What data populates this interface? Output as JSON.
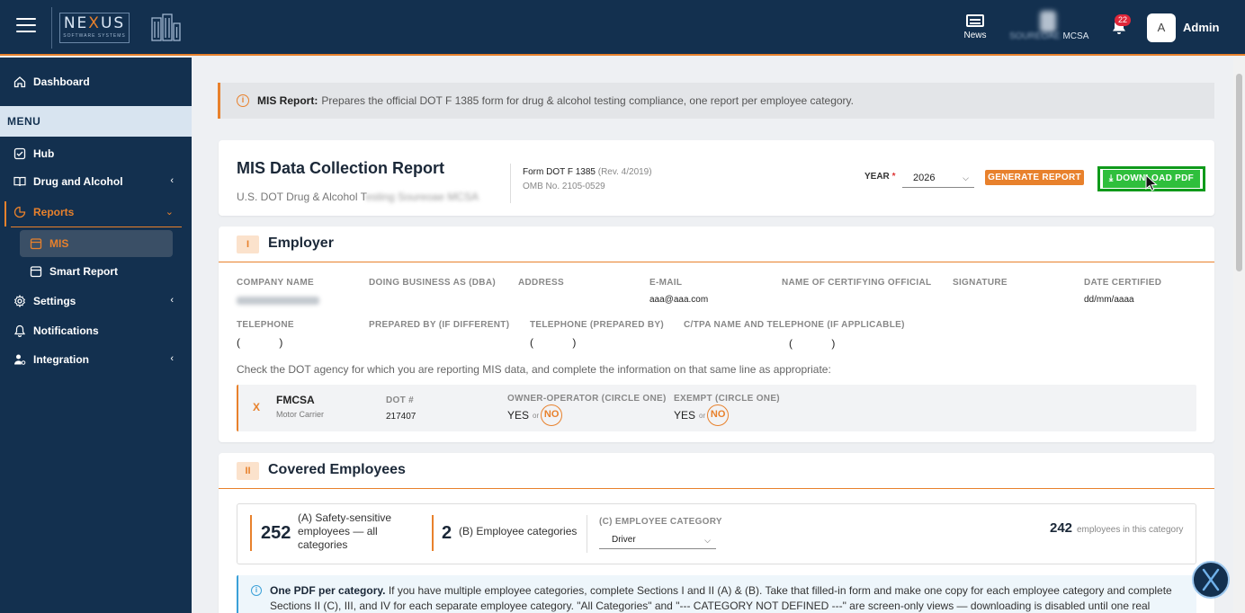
{
  "topbar": {
    "logo_text_left": "NE",
    "logo_text_mid": "X",
    "logo_text_right": "US",
    "logo_subtext": "SOFTWARE SYSTEMS",
    "news_label": "News",
    "company_text_tail": "MCSA",
    "notification_count": "22",
    "avatar_initial": "A",
    "user_name": "Admin"
  },
  "sidebar": {
    "dashboard": "Dashboard",
    "menu_header": "MENU",
    "hub": "Hub",
    "drug_alcohol": "Drug and Alcohol",
    "reports": "Reports",
    "mis": "MIS",
    "smart_report": "Smart Report",
    "settings": "Settings",
    "notifications": "Notifications",
    "integration": "Integration"
  },
  "banner": {
    "bold": "MIS Report:",
    "text": "Prepares the official DOT F 1385 form for drug & alcohol testing compliance, one report per employee category."
  },
  "header": {
    "title": "MIS Data Collection Report",
    "subtitle": "U.S. DOT Drug & Alcohol T",
    "form_name": "Form DOT F 1385",
    "form_rev": "(Rev. 4/2019)",
    "omb": "OMB No. 2105-0529",
    "year_label": "YEAR",
    "year_required": "*",
    "year_value": "2026",
    "generate_label": "GENERATE REPORT",
    "download_label": "DOWNLOAD PDF"
  },
  "employer": {
    "section_num": "I",
    "section_title": "Employer",
    "labels": {
      "company_name": "COMPANY NAME",
      "dba": "DOING BUSINESS AS (DBA)",
      "address": "ADDRESS",
      "email": "E-MAIL",
      "certifying_official": "NAME OF CERTIFYING OFFICIAL",
      "signature": "SIGNATURE",
      "date_certified": "DATE CERTIFIED",
      "telephone": "TELEPHONE",
      "prepared_by": "PREPARED BY (IF DIFFERENT)",
      "telephone_prepared": "TELEPHONE (PREPARED BY)",
      "ctpa": "C/TPA NAME AND TELEPHONE (IF APPLICABLE)"
    },
    "email_value": "aaa@aaa.com",
    "date_value": "dd/mm/aaaa",
    "paren_value": "( )",
    "check_text": "Check the DOT agency for which you are reporting MIS data, and complete the information on that same line as appropriate:",
    "agency": {
      "mark": "X",
      "name": "FMCSA",
      "type": "Motor Carrier",
      "dot_label": "DOT #",
      "dot_value": "217407",
      "owner_label": "OWNER-OPERATOR (CIRCLE ONE)",
      "exempt_label": "EXEMPT (CIRCLE ONE)",
      "yes": "YES",
      "or": "or",
      "no": "NO"
    }
  },
  "covered": {
    "section_num": "II",
    "section_title": "Covered Employees",
    "stat_a_num": "252",
    "stat_a_text": "(A) Safety-sensitive employees — all categories",
    "stat_b_num": "2",
    "stat_b_text": "(B) Employee categories",
    "category_label": "(C) EMPLOYEE CATEGORY",
    "category_value": "Driver",
    "count_num": "242",
    "count_text": "employees in this category",
    "note_bold": "One PDF per category.",
    "note_text": "If you have multiple employee categories, complete Sections I and II (A) & (B). Take that filled-in form and make one copy for each employee category and complete Sections II (C), III, and IV for each separate employee category. \"All Categories\" and \"--- CATEGORY NOT DEFINED ---\" are screen-only views — downloading is disabled until one real category is chosen."
  },
  "colors": {
    "navy": "#13304f",
    "accent": "#e8812c",
    "download_green": "#2fbf3c",
    "highlight_green": "#0f9a1a"
  }
}
